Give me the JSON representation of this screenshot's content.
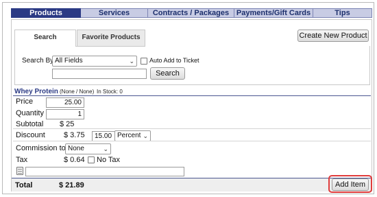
{
  "top_tabs": [
    {
      "label": "Products",
      "active": true
    },
    {
      "label": "Services",
      "active": false
    },
    {
      "label": "Contracts / Packages",
      "active": false
    },
    {
      "label": "Payments/Gift Cards",
      "active": false
    },
    {
      "label": "Tips",
      "active": false
    }
  ],
  "sub_tabs": {
    "search": "Search",
    "favorites": "Favorite Products"
  },
  "create_button": "Create New Product",
  "search": {
    "search_by_label": "Search By",
    "search_by_value": "All Fields",
    "auto_add_label": "Auto Add to Ticket",
    "query": "",
    "search_button": "Search"
  },
  "product": {
    "name": "Whey Protein",
    "codes": "(None / None)",
    "stock": "In Stock: 0"
  },
  "form": {
    "price_label": "Price",
    "price_value": "25.00",
    "quantity_label": "Quantity",
    "quantity_value": "1",
    "subtotal_label": "Subtotal",
    "subtotal_value": "$ 25",
    "discount_label": "Discount",
    "discount_amount": "$ 3.75",
    "discount_value": "15.00",
    "discount_type": "Percent",
    "commission_label": "Commission to",
    "commission_value": "None",
    "tax_label": "Tax",
    "tax_value": "$ 0.64",
    "no_tax_label": "No Tax",
    "note_value": ""
  },
  "total": {
    "label": "Total",
    "value": "$ 21.89"
  },
  "add_item_button": "Add Item",
  "colors": {
    "active_tab": "#2b3a84",
    "inactive_tab": "#c8cce4",
    "highlight": "#e03c3c"
  }
}
